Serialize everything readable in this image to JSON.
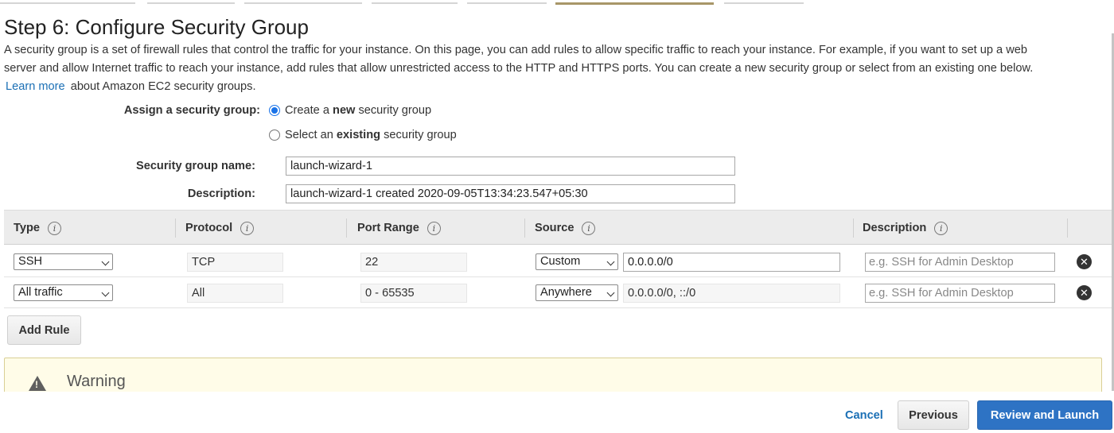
{
  "header": {
    "title": "Step 6: Configure Security Group",
    "intro_line1": "A security group is a set of firewall rules that control the traffic for your instance. On this page, you can add rules to allow specific traffic to reach your instance. For example, if you want to set up a web",
    "intro_line2": "server and allow Internet traffic to reach your instance, add rules that allow unrestricted access to the HTTP and HTTPS ports. You can create a new security group or select from an existing one below.",
    "learn_more": "Learn more",
    "learn_more_suffix": "about Amazon EC2 security groups."
  },
  "assign": {
    "label": "Assign a security group:",
    "option_new_prefix": "Create a ",
    "option_new_bold": "new",
    "option_new_suffix": " security group",
    "option_existing_prefix": "Select an ",
    "option_existing_bold": "existing",
    "option_existing_suffix": " security group",
    "selected": "new"
  },
  "form": {
    "name_label": "Security group name:",
    "name_value": "launch-wizard-1",
    "description_label": "Description:",
    "description_value": "launch-wizard-1 created 2020-09-05T13:34:23.547+05:30"
  },
  "rules_table": {
    "columns": [
      "Type",
      "Protocol",
      "Port Range",
      "Source",
      "Description"
    ],
    "info_glyph": "i",
    "rows": [
      {
        "type": "SSH",
        "protocol": "TCP",
        "port_range": "22",
        "source_mode": "Custom",
        "source_value": "0.0.0.0/0",
        "description_placeholder": "e.g. SSH for Admin Desktop"
      },
      {
        "type": "All traffic",
        "protocol": "All",
        "port_range": "0 - 65535",
        "source_mode": "Anywhere",
        "source_value": "0.0.0.0/0, ::/0",
        "description_placeholder": "e.g. SSH for Admin Desktop"
      }
    ],
    "remove_glyph": "✕"
  },
  "actions": {
    "add_rule": "Add Rule",
    "cancel": "Cancel",
    "previous": "Previous",
    "review_and_launch": "Review and Launch"
  },
  "warning": {
    "title": "Warning",
    "icon": "warning-triangle-icon",
    "glyph": "!"
  },
  "colors": {
    "link": "#1a6fb5",
    "primary_button": "#2e73c4",
    "radio_selected": "#1a73e8",
    "warning_bg": "#fffce8",
    "progress_active": "#a89668"
  }
}
